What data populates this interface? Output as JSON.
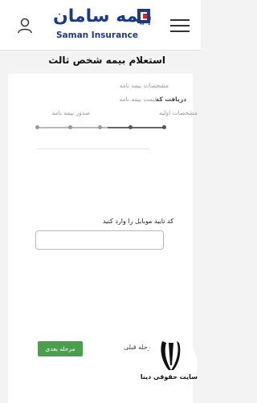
{
  "header": {
    "logo_fa": "بیمه سامان",
    "logo_en": "Saman Insurance"
  },
  "page_title": "استعلام بیمه شخص ثالث",
  "steps": [
    {
      "label": "مشخصات اولیه",
      "state": "done"
    },
    {
      "label": "دریافت کد",
      "state": "active"
    },
    {
      "label": "مشخصات بیمه نامه",
      "state": "pending"
    },
    {
      "label": "قیمت بیمه نامه",
      "state": "pending"
    },
    {
      "label": "صدور بیمه نامه",
      "state": "pending"
    }
  ],
  "form": {
    "code_label": "کد تایید موبایل را وارد کنید",
    "code_value": ""
  },
  "actions": {
    "next_label": "مرحله بعدی",
    "prev_label": "مرحله قبلی"
  },
  "watermark": {
    "text": "سایت حقوقی دینا"
  },
  "colors": {
    "brand": "#1a3a8c",
    "accent": "#d9232d",
    "next_button": "#48a14a"
  }
}
